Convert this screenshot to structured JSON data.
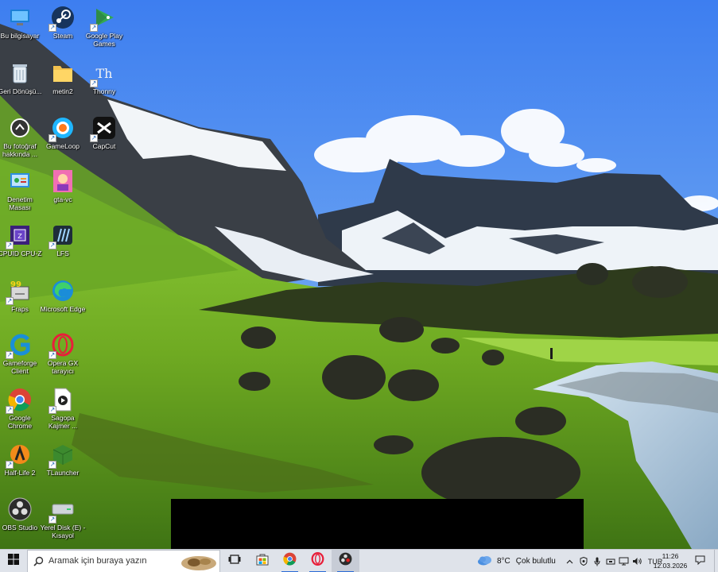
{
  "desktop": {
    "icons": [
      {
        "label": "Bu bilgisayar",
        "icon": "computer-icon"
      },
      {
        "label": "Steam",
        "icon": "steam-icon"
      },
      {
        "label": "Google Play Games",
        "icon": "google-play-games-icon"
      },
      {
        "label": "Geri Dönüşü...",
        "icon": "recycle-bin-icon"
      },
      {
        "label": "metin2",
        "icon": "folder-icon"
      },
      {
        "label": "Thonny",
        "icon": "thonny-icon"
      },
      {
        "label": "Bu fotoğraf hakkında ...",
        "icon": "about-photo-icon"
      },
      {
        "label": "GameLoop",
        "icon": "gameloop-icon"
      },
      {
        "label": "CapCut",
        "icon": "capcut-icon"
      },
      {
        "label": "Denetim Masası",
        "icon": "control-panel-icon"
      },
      {
        "label": "gta-vc",
        "icon": "gta-vc-icon"
      },
      {
        "label": "CPUID CPU-Z",
        "icon": "cpu-z-icon"
      },
      {
        "label": "LFS",
        "icon": "lfs-icon"
      },
      {
        "label": "Fraps",
        "icon": "fraps-icon"
      },
      {
        "label": "Microsoft Edge",
        "icon": "edge-icon"
      },
      {
        "label": "Gameforge Client",
        "icon": "gameforge-icon"
      },
      {
        "label": "Opera GX tarayıcı",
        "icon": "opera-gx-icon"
      },
      {
        "label": "Google Chrome",
        "icon": "chrome-icon"
      },
      {
        "label": "Sagopa Kajmer ...",
        "icon": "video-file-icon"
      },
      {
        "label": "Half-Life 2",
        "icon": "half-life-icon"
      },
      {
        "label": "TLauncher",
        "icon": "tlauncher-icon"
      },
      {
        "label": "OBS Studio",
        "icon": "obs-icon"
      },
      {
        "label": "Yerel Disk (E) - Kısayol",
        "icon": "disk-drive-icon"
      }
    ]
  },
  "taskbar": {
    "search_placeholder": "Aramak için buraya yazın",
    "apps": [
      {
        "name": "task-view",
        "icon": "task-view-icon"
      },
      {
        "name": "store",
        "icon": "store-icon"
      },
      {
        "name": "chrome",
        "icon": "chrome-icon"
      },
      {
        "name": "opera",
        "icon": "opera-icon"
      },
      {
        "name": "obs",
        "icon": "obs-icon"
      }
    ],
    "weather": {
      "temp": "8°C",
      "desc": "Çok bulutlu"
    },
    "language": "TUR",
    "time": "11:26",
    "date": "12.03.2026"
  },
  "colors": {
    "taskbar_bg": "#dfe3ea",
    "accent": "#2a6bd6",
    "sky_top": "#3d7ef0",
    "grass": "#7fbf2a"
  }
}
